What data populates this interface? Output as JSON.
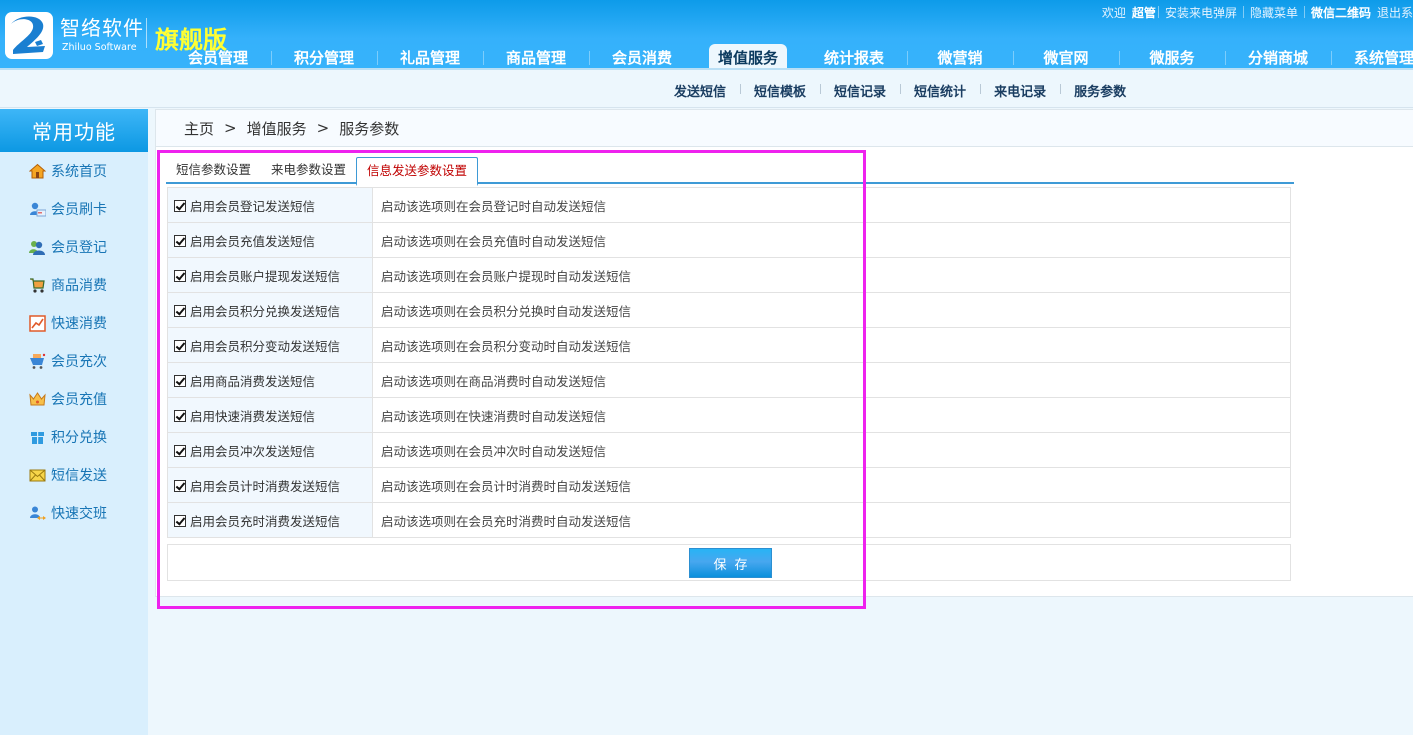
{
  "header": {
    "brand_cn": "智络软件",
    "brand_en": "Zhiluo Software",
    "edition": "旗舰版",
    "top_links": {
      "welcome": "欢迎",
      "user": "超管",
      "install_popup": "安装来电弹屏",
      "hide_menu": "隐藏菜单",
      "wechat_qr": "微信二维码",
      "logout": "退出系统"
    },
    "nav": [
      {
        "label": "会员管理"
      },
      {
        "label": "积分管理"
      },
      {
        "label": "礼品管理"
      },
      {
        "label": "商品管理"
      },
      {
        "label": "会员消费"
      },
      {
        "label": "增值服务",
        "active": true
      },
      {
        "label": "统计报表"
      },
      {
        "label": "微营销"
      },
      {
        "label": "微官网"
      },
      {
        "label": "微服务"
      },
      {
        "label": "分销商城"
      },
      {
        "label": "系统管理"
      }
    ]
  },
  "subnav": [
    "发送短信",
    "短信模板",
    "短信记录",
    "短信统计",
    "来电记录",
    "服务参数"
  ],
  "sidebar": {
    "title": "常用功能",
    "items": [
      {
        "label": "系统首页",
        "icon": "home-icon"
      },
      {
        "label": "会员刷卡",
        "icon": "member-card-icon"
      },
      {
        "label": "会员登记",
        "icon": "users-icon"
      },
      {
        "label": "商品消费",
        "icon": "cart-icon"
      },
      {
        "label": "快速消费",
        "icon": "chart-icon"
      },
      {
        "label": "会员充次",
        "icon": "cart-refill-icon"
      },
      {
        "label": "会员充值",
        "icon": "crown-icon"
      },
      {
        "label": "积分兑换",
        "icon": "gift-icon"
      },
      {
        "label": "短信发送",
        "icon": "mail-icon"
      },
      {
        "label": "快速交班",
        "icon": "user-swap-icon"
      }
    ]
  },
  "breadcrumb": [
    "主页",
    ">",
    "增值服务",
    ">",
    "服务参数"
  ],
  "tabs": [
    {
      "label": "短信参数设置"
    },
    {
      "label": "来电参数设置"
    },
    {
      "label": "信息发送参数设置",
      "active": true
    }
  ],
  "settings": [
    {
      "label": "启用会员登记发送短信",
      "checked": true,
      "description": "启动该选项则在会员登记时自动发送短信"
    },
    {
      "label": "启用会员充值发送短信",
      "checked": true,
      "description": "启动该选项则在会员充值时自动发送短信"
    },
    {
      "label": "启用会员账户提现发送短信",
      "checked": true,
      "description": "启动该选项则在会员账户提现时自动发送短信"
    },
    {
      "label": "启用会员积分兑换发送短信",
      "checked": true,
      "description": "启动该选项则在会员积分兑换时自动发送短信"
    },
    {
      "label": "启用会员积分变动发送短信",
      "checked": true,
      "description": "启动该选项则在会员积分变动时自动发送短信"
    },
    {
      "label": "启用商品消费发送短信",
      "checked": true,
      "description": "启动该选项则在商品消费时自动发送短信"
    },
    {
      "label": "启用快速消费发送短信",
      "checked": true,
      "description": "启动该选项则在快速消费时自动发送短信"
    },
    {
      "label": "启用会员冲次发送短信",
      "checked": true,
      "description": "启动该选项则在会员冲次时自动发送短信"
    },
    {
      "label": "启用会员计时消费发送短信",
      "checked": true,
      "description": "启动该选项则在会员计时消费时自动发送短信"
    },
    {
      "label": "启用会员充时消费发送短信",
      "checked": true,
      "description": "启动该选项则在会员充时消费时自动发送短信"
    }
  ],
  "save_label": "保存",
  "colors": {
    "header_blue": "#36b3fb",
    "active_tab_text": "#c00000",
    "highlight_border": "#ee22ee",
    "edition_yellow": "#ffff33"
  }
}
